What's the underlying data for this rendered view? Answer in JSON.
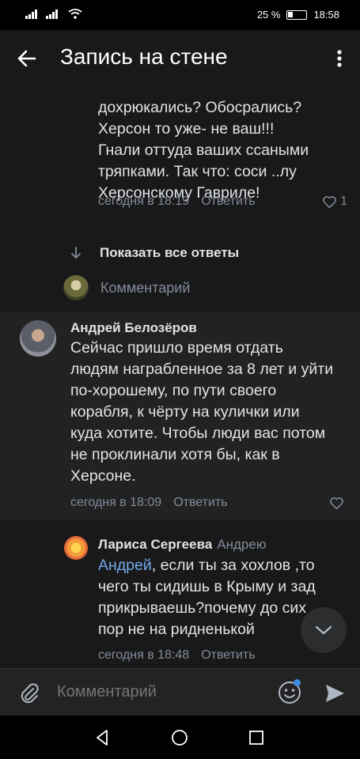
{
  "status": {
    "battery": "25 %",
    "time": "18:58"
  },
  "topbar": {
    "title": "Запись на стене"
  },
  "comments": [
    {
      "lines_partial": [
        "дохрюкались? Обосрались?",
        "Херсон то уже- не ваш!!!",
        "Гнали оттуда ваших ссаными",
        "тряпками. Так что: соси ..лу",
        "Херсонскому Гавриле!"
      ],
      "time": "сегодня в 18:19",
      "reply": "Ответить",
      "likes": "1"
    },
    {
      "author": "Андрей Белозёров",
      "text": "Сейчас пришло время отдать людям награбленное за 8 лет и уйти по-хорошему, по пути своего корабля, к чёрту на кулички или куда хотите. Чтобы люди вас потом не проклинали хотя бы, как в Херсоне.",
      "time": "сегодня в 18:09",
      "reply": "Ответить"
    },
    {
      "author": "Лариса Сергеева",
      "reply_to": "Андрею",
      "mention": "Андрей",
      "text": ", если ты за хохлов ,то чего ты сидишь в Крыму и зад прикрываешь?почему до сих пор не на ридненькой",
      "time": "сегодня в 18:48",
      "reply": "Ответить"
    }
  ],
  "show_all_replies": "Показать все ответы",
  "mini_comment_placeholder": "Комментарий",
  "composer": {
    "placeholder": "Комментарий"
  },
  "icons": [
    "back-arrow-icon",
    "more-vertical-icon",
    "arrow-down-icon",
    "heart-icon",
    "chevron-down-icon",
    "paperclip-icon",
    "emoji-icon",
    "send-icon",
    "nav-back-icon",
    "nav-home-icon",
    "nav-recents-icon"
  ],
  "colors": {
    "background": "#19191a",
    "accent": "#71aaeb",
    "secondary_text": "#818c99",
    "badge": "#3f8ae0"
  }
}
